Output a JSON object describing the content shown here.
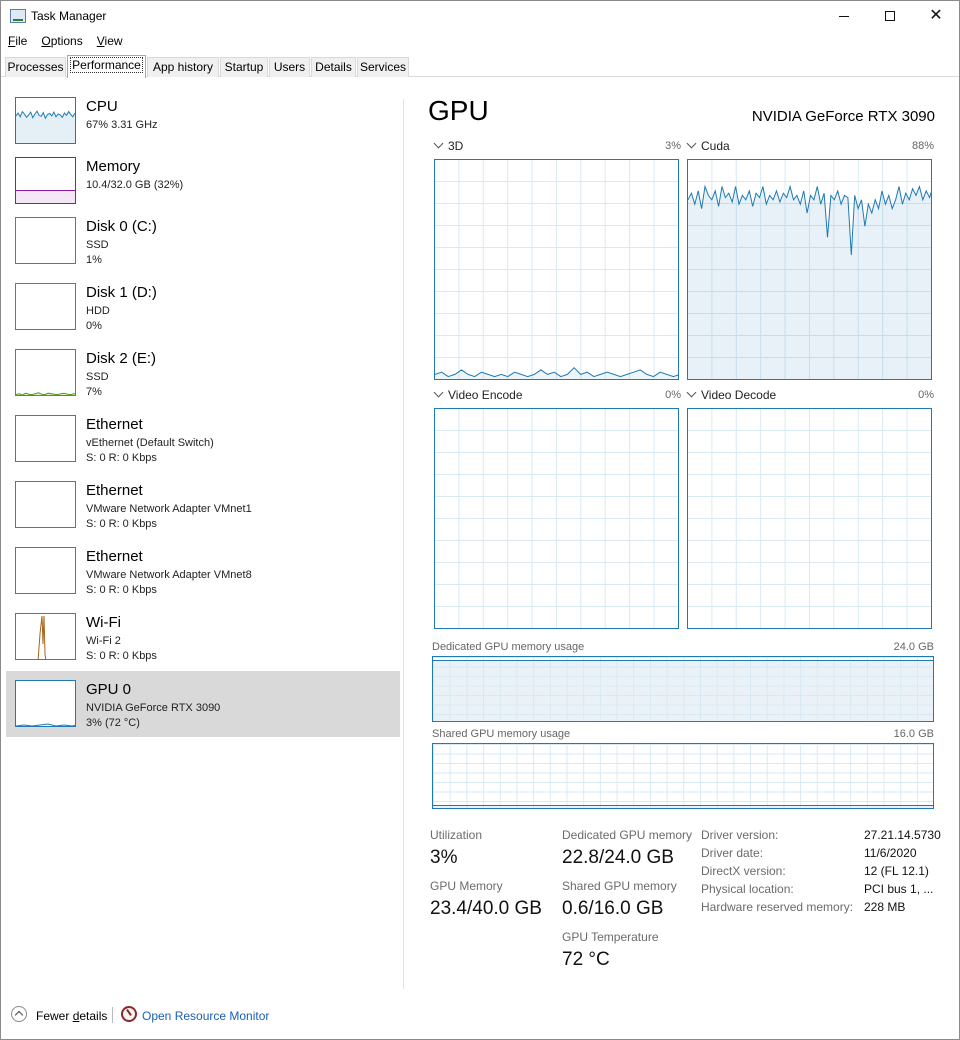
{
  "window": {
    "title": "Task Manager"
  },
  "menu": [
    {
      "label": "File",
      "accel": "F",
      "rest": "ile"
    },
    {
      "label": "Options",
      "accel": "O",
      "rest": "ptions"
    },
    {
      "label": "View",
      "accel": "V",
      "rest": "iew"
    }
  ],
  "tabs": [
    "Processes",
    "Performance",
    "App history",
    "Startup",
    "Users",
    "Details",
    "Services"
  ],
  "active_tab": "Performance",
  "sidebar": {
    "items": [
      {
        "title": "CPU",
        "lines": [
          "67%  3.31 GHz"
        ],
        "color": "#1f7ab3"
      },
      {
        "title": "Memory",
        "lines": [
          "10.4/32.0 GB (32%)"
        ],
        "color": "#8b1a9e"
      },
      {
        "title": "Disk 0 (C:)",
        "lines": [
          "SSD",
          "1%"
        ],
        "color": "#4e9a06"
      },
      {
        "title": "Disk 1 (D:)",
        "lines": [
          "HDD",
          "0%"
        ],
        "color": "#4e9a06"
      },
      {
        "title": "Disk 2 (E:)",
        "lines": [
          "SSD",
          "7%"
        ],
        "color": "#4e9a06"
      },
      {
        "title": "Ethernet",
        "lines": [
          "vEthernet (Default Switch)",
          "S: 0  R: 0 Kbps"
        ],
        "color": "#a7631a"
      },
      {
        "title": "Ethernet",
        "lines": [
          "VMware Network Adapter VMnet1",
          "S: 0  R: 0 Kbps"
        ],
        "color": "#a7631a"
      },
      {
        "title": "Ethernet",
        "lines": [
          "VMware Network Adapter VMnet8",
          "S: 0  R: 0 Kbps"
        ],
        "color": "#a7631a"
      },
      {
        "title": "Wi-Fi",
        "lines": [
          "Wi-Fi 2",
          "S: 0  R: 0 Kbps"
        ],
        "color": "#a7631a"
      },
      {
        "title": "GPU 0",
        "lines": [
          "NVIDIA GeForce RTX 3090",
          "3% (72 °C)"
        ],
        "color": "#1f7ab3",
        "selected": true
      }
    ]
  },
  "gpu": {
    "title": "GPU",
    "model": "NVIDIA GeForce RTX 3090",
    "engines": [
      {
        "label": "3D",
        "pct": "3%"
      },
      {
        "label": "Cuda",
        "pct": "88%"
      },
      {
        "label": "Video Encode",
        "pct": "0%"
      },
      {
        "label": "Video Decode",
        "pct": "0%"
      }
    ],
    "dedicated_label": "Dedicated GPU memory usage",
    "dedicated_max": "24.0 GB",
    "dedicated_level": 0.95,
    "shared_label": "Shared GPU memory usage",
    "shared_max": "16.0 GB",
    "shared_level": 0.04,
    "stats": {
      "utilization_label": "Utilization",
      "utilization": "3%",
      "dedicated_mem_label": "Dedicated GPU memory",
      "dedicated_mem": "22.8/24.0 GB",
      "gpu_mem_label": "GPU Memory",
      "gpu_mem": "23.4/40.0 GB",
      "shared_mem_label": "Shared GPU memory",
      "shared_mem": "0.6/16.0 GB",
      "temp_label": "GPU Temperature",
      "temp": "72 °C"
    },
    "info": [
      {
        "key": "Driver version:",
        "value": "27.21.14.5730"
      },
      {
        "key": "Driver date:",
        "value": "11/6/2020"
      },
      {
        "key": "DirectX version:",
        "value": "12 (FL 12.1)"
      },
      {
        "key": "Physical location:",
        "value": "PCI bus 1, ..."
      },
      {
        "key": "Hardware reserved memory:",
        "value": "228 MB"
      }
    ]
  },
  "footer": {
    "fewer": "Fewer details",
    "fewer_accel": "d",
    "resource_monitor": "Open Resource Monitor"
  },
  "series": {
    "cpu_thumb": [
      62,
      68,
      60,
      71,
      66,
      59,
      64,
      70,
      58,
      66,
      72,
      63,
      61,
      69,
      57,
      65,
      67,
      62,
      70,
      60,
      66,
      64,
      59,
      68,
      63,
      71,
      65,
      60,
      67,
      62
    ],
    "cuda": [
      82,
      85,
      80,
      86,
      78,
      88,
      84,
      82,
      86,
      79,
      88,
      83,
      85,
      81,
      88,
      80,
      84,
      82,
      86,
      79,
      85,
      83,
      88,
      80,
      84,
      82,
      86,
      81,
      85,
      83,
      88,
      82,
      84,
      80,
      86,
      76,
      84,
      82,
      88,
      80,
      85,
      65,
      84,
      82,
      86,
      80,
      84,
      83,
      57,
      84,
      78,
      82,
      70,
      80,
      76,
      82,
      78,
      86,
      80,
      84,
      78,
      82,
      88,
      80,
      85,
      82,
      87,
      84,
      88,
      82,
      86,
      83,
      88
    ],
    "gpu3d": [
      3,
      4,
      2,
      3,
      5,
      3,
      2,
      4,
      3,
      2,
      3,
      2,
      4,
      3,
      2,
      3,
      5,
      3,
      4,
      2,
      3,
      6,
      3,
      4,
      2,
      3,
      4,
      3,
      2,
      3,
      4,
      5,
      3,
      2,
      4,
      3,
      2,
      3
    ],
    "disk2_thumb": [
      5,
      7,
      4,
      8,
      6,
      5,
      7,
      9,
      6,
      5,
      8,
      7,
      6,
      5,
      7,
      8,
      6,
      5,
      7,
      6
    ]
  }
}
